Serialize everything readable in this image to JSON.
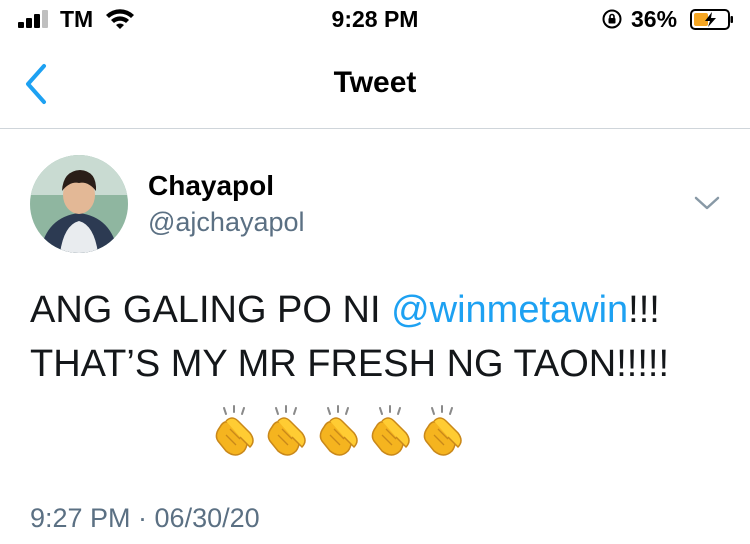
{
  "status_bar": {
    "carrier": "TM",
    "time": "9:28 PM",
    "battery_percent": "36%",
    "signal_bars": 3,
    "icons": [
      "signal-bars-icon",
      "wifi-icon",
      "orientation-lock-icon",
      "battery-charging-icon"
    ]
  },
  "nav": {
    "title": "Tweet",
    "back_icon": "chevron-left-icon"
  },
  "tweet": {
    "author_name": "Chayapol",
    "author_handle": "@ajchayapol",
    "text_part1": "ANG GALING PO NI ",
    "mention": "@winmetawin",
    "text_part2": "!!! THAT’S MY MR FRESH NG TAON!!!!!",
    "emoji_count": 5,
    "emoji": "clapping-hands-icon",
    "timestamp": "9:27 PM · 06/30/20"
  },
  "colors": {
    "accent": "#1da1f2",
    "secondary_text": "#5b7083",
    "battery_charging": "#f5a623"
  }
}
